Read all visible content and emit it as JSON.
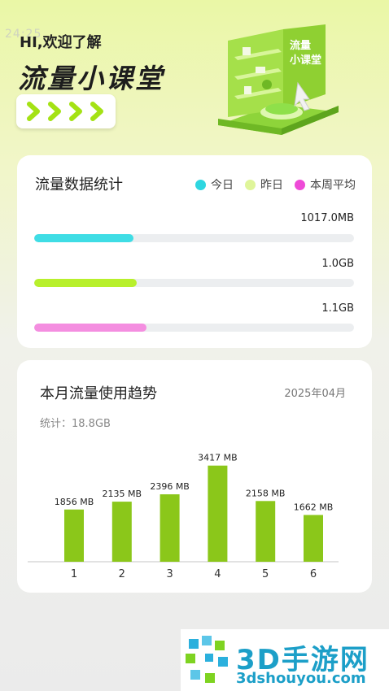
{
  "header": {
    "faint_time": "24:25",
    "greeting": "HI,欢迎了解",
    "title": "流量小课堂",
    "illustration_label": "流量\n小课堂"
  },
  "stats_card": {
    "title": "流量数据统计",
    "legend": [
      {
        "label": "今日",
        "color": "#2ed6e0"
      },
      {
        "label": "昨日",
        "color": "#dff59a"
      },
      {
        "label": "本周平均",
        "color": "#ee4ad7"
      }
    ],
    "bars": [
      {
        "value_label": "1017.0MB",
        "fraction": 0.31,
        "color": "#3fdde5"
      },
      {
        "value_label": "1.0GB",
        "fraction": 0.32,
        "color": "#b8f02c"
      },
      {
        "value_label": "1.1GB",
        "fraction": 0.35,
        "color": "#f48ee0"
      }
    ]
  },
  "trend_card": {
    "title": "本月流量使用趋势",
    "month": "2025年04月",
    "total": "统计：18.8GB"
  },
  "chart_data": {
    "type": "bar",
    "categories": [
      "1",
      "2",
      "3",
      "4",
      "5",
      "6"
    ],
    "values": [
      1856,
      2135,
      2396,
      3417,
      2158,
      1662
    ],
    "labels": [
      "1856 MB",
      "2135 MB",
      "2396 MB",
      "3417 MB",
      "2158 MB",
      "1662 MB"
    ],
    "ylim": [
      0,
      3900
    ],
    "color": "#8bc71a",
    "grid": false
  },
  "watermark": {
    "text": "3D手游网",
    "url": "3dshouyou.com"
  }
}
